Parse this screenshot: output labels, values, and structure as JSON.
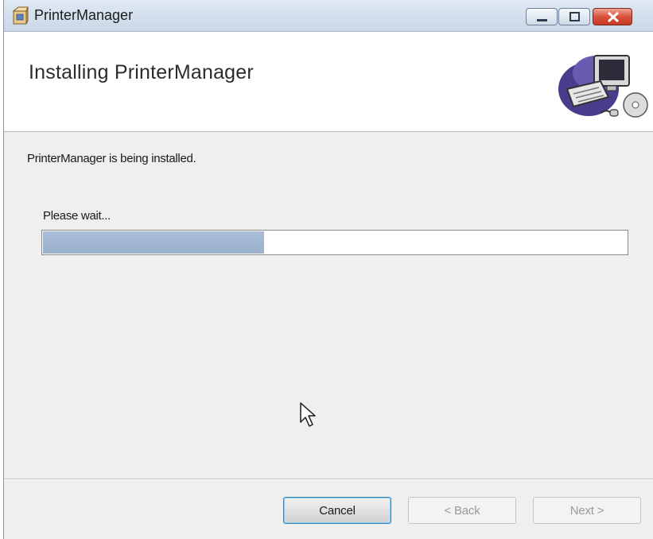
{
  "window": {
    "title": "PrinterManager"
  },
  "header": {
    "title": "Installing PrinterManager"
  },
  "body": {
    "status_text": "PrinterManager is being installed.",
    "wait_text": "Please wait...",
    "progress_percent": 38
  },
  "footer": {
    "cancel_label": "Cancel",
    "back_label": "< Back",
    "next_label": "Next >"
  },
  "colors": {
    "progress_fill": "#a9bdd6",
    "close_button": "#d9533c",
    "dialog_background": "#efefef"
  },
  "icons": {
    "app": "installer-package-icon",
    "header": "computer-setup-icon",
    "cursor": "mouse-pointer-icon"
  }
}
